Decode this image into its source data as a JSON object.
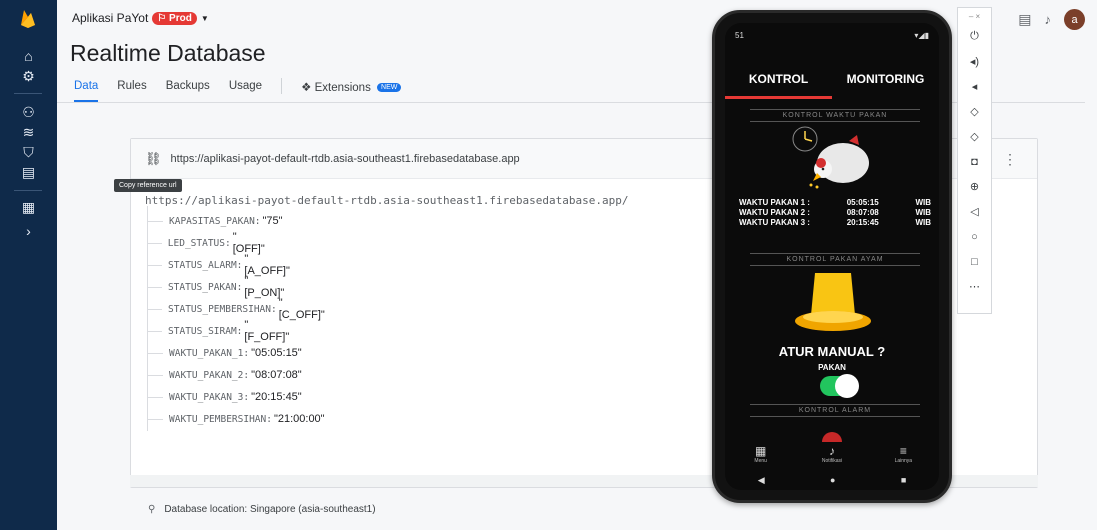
{
  "project": {
    "name": "Aplikasi PaYot",
    "badge": "Prod"
  },
  "page_title": "Realtime Database",
  "tabs": [
    "Data",
    "Rules",
    "Backups",
    "Usage",
    "Extensions"
  ],
  "extensions_badge": "NEW",
  "reference_url": "https://aplikasi-payot-default-rtdb.asia-southeast1.firebasedatabase.app",
  "tooltip": "Copy reference url",
  "root_url": "https://aplikasi-payot-default-rtdb.asia-southeast1.firebasedatabase.app/",
  "nodes": [
    {
      "key": "KAPASITAS_PAKAN:",
      "value": "\"75\""
    },
    {
      "key": "LED_STATUS:",
      "value": "\"[OFF]\""
    },
    {
      "key": "STATUS_ALARM:",
      "value": "\"[A_OFF]\""
    },
    {
      "key": "STATUS_PAKAN:",
      "value": "\"[P_ON]\""
    },
    {
      "key": "STATUS_PEMBERSIHAN:",
      "value": "\"[C_OFF]\""
    },
    {
      "key": "STATUS_SIRAM:",
      "value": "\"[F_OFF]\""
    },
    {
      "key": "WAKTU_PAKAN_1:",
      "value": "\"05:05:15\""
    },
    {
      "key": "WAKTU_PAKAN_2:",
      "value": "\"08:07:08\""
    },
    {
      "key": "WAKTU_PAKAN_3:",
      "value": "\"20:15:45\""
    },
    {
      "key": "WAKTU_PEMBERSIHAN:",
      "value": "\"21:00:00\""
    }
  ],
  "location": "Database location: Singapore (asia-southeast1)",
  "avatar_letter": "a",
  "phone": {
    "status_time": "51",
    "tabs": [
      "KONTROL",
      "MONITORING"
    ],
    "section_pakan": "KONTROL WAKTU PAKAN",
    "times": [
      {
        "label": "WAKTU PAKAN 1 :",
        "time": "05:05:15",
        "zone": "WIB"
      },
      {
        "label": "WAKTU PAKAN 2 :",
        "time": "08:07:08",
        "zone": "WIB"
      },
      {
        "label": "WAKTU PAKAN 3 :",
        "time": "20:15:45",
        "zone": "WIB"
      }
    ],
    "section_ayam": "KONTROL PAKAN AYAM",
    "manual_title": "ATUR MANUAL ?",
    "manual_label": "PAKAN",
    "manual_on": true,
    "section_alarm": "KONTROL ALARM",
    "bottom_nav": [
      "Menu",
      "Notifikasi",
      "Lainnya"
    ]
  },
  "colors": {
    "rail": "#0f2a4a",
    "accent": "#1a73e8",
    "prod": "#e53935",
    "toggle": "#22c55e"
  }
}
